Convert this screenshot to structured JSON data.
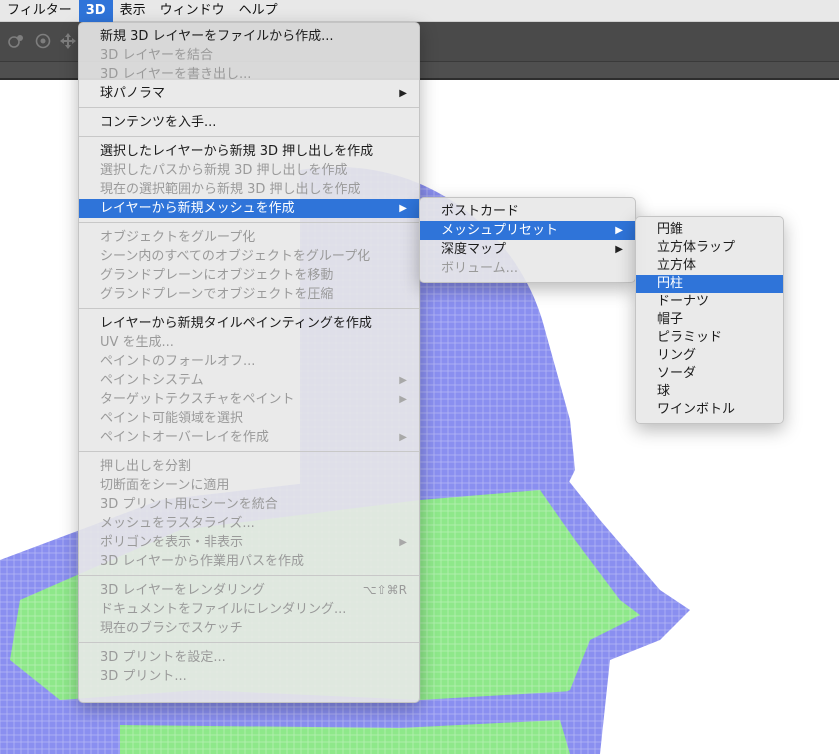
{
  "menubar": {
    "items": [
      {
        "label": "フィルター",
        "active": false
      },
      {
        "label": "3D",
        "active": true
      },
      {
        "label": "表示",
        "active": false
      },
      {
        "label": "ウィンドウ",
        "active": false
      },
      {
        "label": "ヘルプ",
        "active": false
      }
    ]
  },
  "toolbar": {
    "icons": [
      "orbit-3d-icon",
      "roll-3d-icon",
      "pan-3d-icon"
    ]
  },
  "menu_3d": {
    "groups": [
      [
        {
          "label": "新規 3D レイヤーをファイルから作成...",
          "disabled": false
        },
        {
          "label": "3D レイヤーを結合",
          "disabled": true
        },
        {
          "label": "3D レイヤーを書き出し...",
          "disabled": true
        },
        {
          "label": "球パノラマ",
          "disabled": false,
          "submenu": true
        }
      ],
      [
        {
          "label": "コンテンツを入手...",
          "disabled": false
        }
      ],
      [
        {
          "label": "選択したレイヤーから新規 3D 押し出しを作成",
          "disabled": false
        },
        {
          "label": "選択したパスから新規 3D 押し出しを作成",
          "disabled": true
        },
        {
          "label": "現在の選択範囲から新規 3D 押し出しを作成",
          "disabled": true
        },
        {
          "label": "レイヤーから新規メッシュを作成",
          "disabled": false,
          "submenu": true,
          "selected": true
        }
      ],
      [
        {
          "label": "オブジェクトをグループ化",
          "disabled": true
        },
        {
          "label": "シーン内のすべてのオブジェクトをグループ化",
          "disabled": true
        },
        {
          "label": "グランドプレーンにオブジェクトを移動",
          "disabled": true
        },
        {
          "label": "グランドプレーンでオブジェクトを圧縮",
          "disabled": true
        }
      ],
      [
        {
          "label": "レイヤーから新規タイルペインティングを作成",
          "disabled": false
        },
        {
          "label": "UV を生成...",
          "disabled": true
        },
        {
          "label": "ペイントのフォールオフ...",
          "disabled": true
        },
        {
          "label": "ペイントシステム",
          "disabled": true,
          "submenu": true
        },
        {
          "label": "ターゲットテクスチャをペイント",
          "disabled": true,
          "submenu": true
        },
        {
          "label": "ペイント可能領域を選択",
          "disabled": true
        },
        {
          "label": "ペイントオーバーレイを作成",
          "disabled": true,
          "submenu": true
        }
      ],
      [
        {
          "label": "押し出しを分割",
          "disabled": true
        },
        {
          "label": "切断面をシーンに適用",
          "disabled": true
        },
        {
          "label": "3D プリント用にシーンを統合",
          "disabled": true
        },
        {
          "label": "メッシュをラスタライズ...",
          "disabled": true
        },
        {
          "label": "ポリゴンを表示・非表示",
          "disabled": true,
          "submenu": true
        },
        {
          "label": "3D レイヤーから作業用パスを作成",
          "disabled": true
        }
      ],
      [
        {
          "label": "3D レイヤーをレンダリング",
          "disabled": true,
          "shortcut": "⌥⇧⌘R"
        },
        {
          "label": "ドキュメントをファイルにレンダリング...",
          "disabled": true
        },
        {
          "label": "現在のブラシでスケッチ",
          "disabled": true
        }
      ],
      [
        {
          "label": "3D プリントを設定...",
          "disabled": true
        },
        {
          "label": "3D プリント...",
          "disabled": true
        }
      ]
    ]
  },
  "menu_mesh": {
    "items": [
      {
        "label": "ポストカード",
        "disabled": false
      },
      {
        "label": "メッシュプリセット",
        "disabled": false,
        "submenu": true,
        "selected": true
      },
      {
        "label": "深度マップ",
        "disabled": false,
        "submenu": true
      },
      {
        "label": "ボリューム...",
        "disabled": true
      }
    ]
  },
  "menu_preset": {
    "items": [
      {
        "label": "円錐",
        "selected": false
      },
      {
        "label": "立方体ラップ",
        "selected": false
      },
      {
        "label": "立方体",
        "selected": false
      },
      {
        "label": "円柱",
        "selected": true
      },
      {
        "label": "ドーナツ",
        "selected": false
      },
      {
        "label": "帽子",
        "selected": false
      },
      {
        "label": "ピラミッド",
        "selected": false
      },
      {
        "label": "リング",
        "selected": false
      },
      {
        "label": "ソーダ",
        "selected": false
      },
      {
        "label": "球",
        "selected": false
      },
      {
        "label": "ワインボトル",
        "selected": false
      }
    ]
  },
  "colors": {
    "accent": "#2f74d9",
    "art_outline": "#8a8ff0",
    "art_fill": "#8ee88a"
  }
}
